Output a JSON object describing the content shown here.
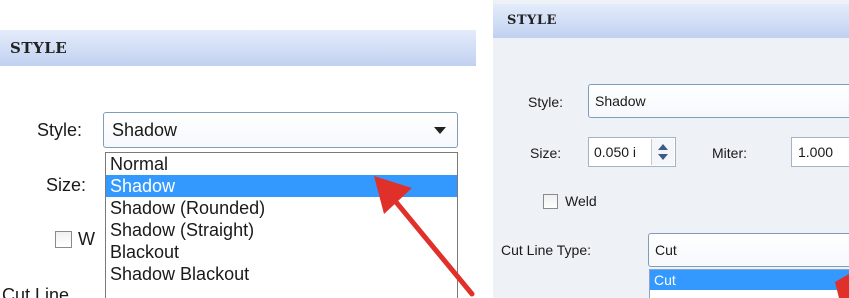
{
  "left": {
    "header": "STYLE",
    "style_label": "Style:",
    "style_value": "Shadow",
    "size_label": "Size:",
    "weld_partial": "W",
    "cutline_partial": "Cut Line",
    "dropdown_options": [
      "Normal",
      "Shadow",
      "Shadow (Rounded)",
      "Shadow (Straight)",
      "Blackout",
      "Shadow Blackout"
    ],
    "selected_index": 1
  },
  "right": {
    "header": "STYLE",
    "style_label": "Style:",
    "style_value": "Shadow",
    "size_label": "Size:",
    "size_value": "0.050 i",
    "miter_label": "Miter:",
    "miter_value": "1.000",
    "weld_label": "Weld",
    "cutline_label": "Cut Line Type:",
    "cutline_value": "Cut",
    "dropdown_options": [
      "Cut"
    ]
  },
  "colors": {
    "highlight": "#3399ff",
    "annotation_arrow": "#e0302a",
    "header_band": "#cfdcf5"
  }
}
